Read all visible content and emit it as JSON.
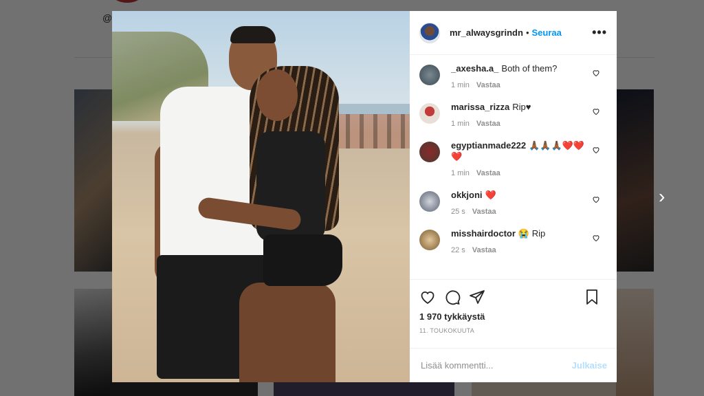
{
  "background": {
    "handle_partial": "@l"
  },
  "post": {
    "username": "mr_alwaysgrindn",
    "separator": "•",
    "follow_label": "Seuraa",
    "more_label": "•••",
    "likes_text": "1 970 tykkäystä",
    "date_text": "11. TOUKOKUUTA"
  },
  "comments": [
    {
      "user": "_axesha.a_",
      "text": "Both of them?",
      "time": "1 min",
      "reply": "Vastaa",
      "avatar": "avatar-gray"
    },
    {
      "user": "marissa_rizza",
      "text": "Rip♥",
      "time": "1 min",
      "reply": "Vastaa",
      "avatar": "avatar-red-figure"
    },
    {
      "user": "egyptianmade222",
      "text": "🙏🏾🙏🏾🙏🏾❤️❤️❤️",
      "time": "1 min",
      "reply": "Vastaa",
      "avatar": "avatar-dark-red"
    },
    {
      "user": "okkjoni",
      "text": "❤️",
      "time": "25 s",
      "reply": "Vastaa",
      "avatar": "avatar-light"
    },
    {
      "user": "misshairdoctor",
      "text": "😭 Rip",
      "time": "22 s",
      "reply": "Vastaa",
      "avatar": "avatar-gold"
    }
  ],
  "add_comment": {
    "placeholder": "Lisää kommentti...",
    "post_label": "Julkaise"
  },
  "navigation": {
    "next_arrow": "›"
  },
  "colors": {
    "accent": "#0095f6",
    "post_button_disabled": "#b2dffc",
    "text": "#262626",
    "muted": "#8e8e8e"
  },
  "icons": [
    "heart-icon",
    "comment-icon",
    "share-icon",
    "save-icon",
    "more-icon",
    "next-arrow-icon"
  ]
}
